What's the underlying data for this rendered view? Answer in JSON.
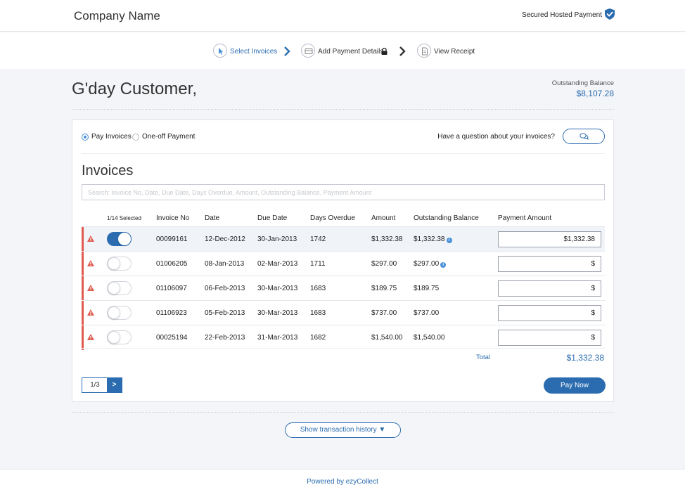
{
  "header": {
    "company_name": "Company Name",
    "secure_label": "Secured Hosted Payment",
    "secure_icon": "shield-check-icon"
  },
  "steps": [
    {
      "label": "Select Invoices",
      "icon": "cursor-icon",
      "active": true
    },
    {
      "label": "Add Payment Details",
      "icon": "card-icon",
      "active": false
    },
    {
      "label": "View Receipt",
      "icon": "receipt-icon",
      "active": false
    }
  ],
  "greeting": "G'day Customer,",
  "outstanding": {
    "label": "Outstanding Balance",
    "value": "$8,107.28"
  },
  "payment_mode": {
    "options": [
      "Pay Invoices",
      "One-off Payment"
    ],
    "selected": "Pay Invoices"
  },
  "question": {
    "label": "Have a question about your invoices?",
    "icon": "chat-icon"
  },
  "invoices": {
    "title": "Invoices",
    "search_placeholder": "Search: Invoice No, Date, Due Date, Days Overdue, Amount, Outstanding Balance, Payment Amount",
    "columns": {
      "selected": "1/14 Selected",
      "invoice_no": "Invoice No",
      "date": "Date",
      "due_date": "Due Date",
      "days_overdue": "Days Overdue",
      "amount": "Amount",
      "outstanding": "Outstanding Balance",
      "payment": "Payment Amount"
    },
    "rows": [
      {
        "invoice_no": "00099161",
        "date": "12-Dec-2012",
        "due_date": "30-Jan-2013",
        "days_overdue": "1742",
        "amount": "$1,332.38",
        "outstanding": "$1,332.38",
        "info": true,
        "selected": true,
        "payment": "$1,332.38"
      },
      {
        "invoice_no": "01006205",
        "date": "08-Jan-2013",
        "due_date": "02-Mar-2013",
        "days_overdue": "1711",
        "amount": "$297.00",
        "outstanding": "$297.00",
        "info": true,
        "selected": false,
        "payment": "$"
      },
      {
        "invoice_no": "01106097",
        "date": "06-Feb-2013",
        "due_date": "30-Mar-2013",
        "days_overdue": "1683",
        "amount": "$189.75",
        "outstanding": "$189.75",
        "info": false,
        "selected": false,
        "payment": "$"
      },
      {
        "invoice_no": "01106923",
        "date": "05-Feb-2013",
        "due_date": "30-Mar-2013",
        "days_overdue": "1683",
        "amount": "$737.00",
        "outstanding": "$737.00",
        "info": false,
        "selected": false,
        "payment": "$"
      },
      {
        "invoice_no": "00025194",
        "date": "22-Feb-2013",
        "due_date": "31-Mar-2013",
        "days_overdue": "1682",
        "amount": "$1,540.00",
        "outstanding": "$1,540.00",
        "info": false,
        "selected": false,
        "payment": "$"
      }
    ],
    "total_label": "Total",
    "total_value": "$1,332.38",
    "pager": {
      "text": "1/3",
      "next": ">"
    },
    "pay_now": "Pay Now"
  },
  "history_button": "Show transaction history ▼",
  "footer": "Powered by ezyCollect",
  "colors": {
    "accent": "#2b6cb0",
    "overdue": "#e05a4f",
    "info": "#4a90d9"
  }
}
